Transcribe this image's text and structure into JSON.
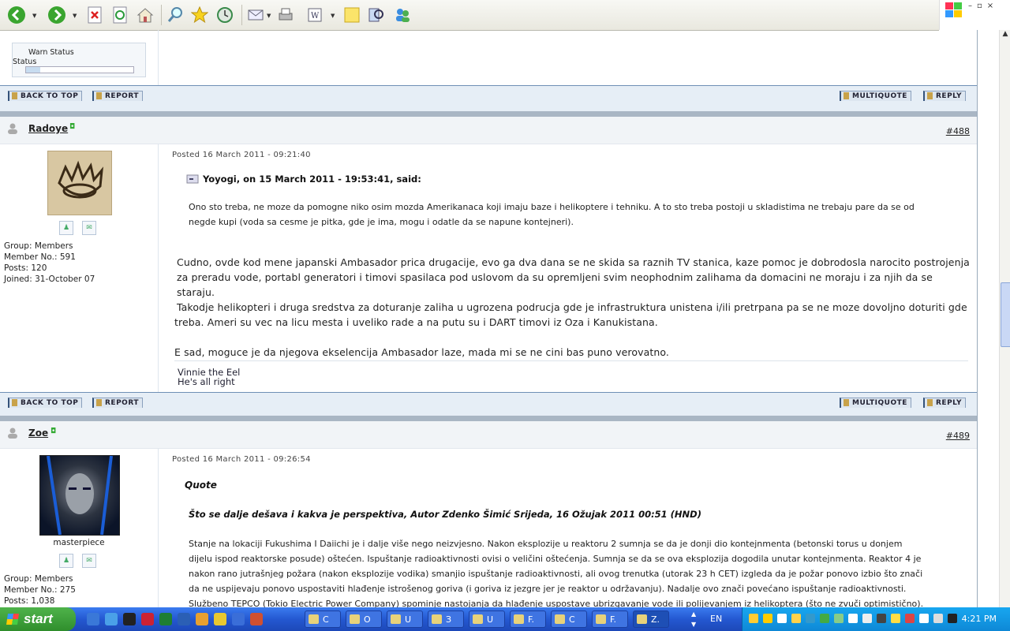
{
  "toolbar": {
    "buttons": [
      "back-icon",
      "forward-icon",
      "stop-icon",
      "refresh-icon",
      "home-icon",
      "search-icon",
      "favorites-icon",
      "history-icon",
      "mail-icon",
      "print-icon",
      "edit-icon",
      "notes-icon",
      "research-icon",
      "messenger-icon"
    ]
  },
  "prev_post": {
    "warn_label": "Warn Status",
    "status_label": "Status"
  },
  "bars": {
    "back_to_top": "BACK TO TOP",
    "report": "REPORT",
    "multiquote": "MULTIQUOTE",
    "reply": "REPLY"
  },
  "posts": [
    {
      "username": "Radoye",
      "number": "#488",
      "posted": "Posted 16 March 2011 - 09:21:40",
      "group_label": "Group:",
      "group": "Members",
      "member_no_label": "Member No.:",
      "member_no": "591",
      "posts_label": "Posts:",
      "posts": "120",
      "joined_label": "Joined:",
      "joined": "31-October 07",
      "quote_header": "Yoyogi, on 15 March 2011 - 19:53:41, said:",
      "quote_lines": [
        "Ono sto treba, ne moze da pomogne niko osim mozda Amerikanaca koji imaju baze i helikoptere i tehniku. A to sto treba postoji u skladistima ne trebaju pare da se od",
        "negde kupi (voda sa cesme je pitka, gde je ima, mogu i odatle da se napune kontejneri)."
      ],
      "body_lines": [
        "Cudno, ovde kod mene japanski Ambasador prica drugacije, evo ga dva dana se ne skida sa raznih TV stanica, kaze pomoc je dobrodosla narocito postrojenja",
        "za preradu vode, portabl generatori i timovi spasilaca pod uslovom da su opremljeni svim neophodnim zalihama da domacini ne moraju i za njih da se staraju.",
        "Takodje helikopteri i druga sredstva za doturanje zaliha u ugrozena podrucja gde je infrastruktura unistena i/ili pretrpana pa se ne moze dovoljno doturiti gde",
        "treba. Ameri su vec na licu mesta i uveliko rade a na putu su i DART timovi iz Oza i Kanukistana."
      ],
      "body_last": "E sad, moguce je da njegova ekselencija Ambasador laze, mada mi se ne cini bas puno verovatno.",
      "signature": [
        "Vinnie the Eel",
        "He's all right"
      ]
    },
    {
      "username": "Zoe",
      "number": "#489",
      "posted": "Posted 16 March 2011 - 09:26:54",
      "title": "masterpiece",
      "group_label": "Group:",
      "group": "Members",
      "member_no_label": "Member No.:",
      "member_no": "275",
      "posts_label": "Posts:",
      "posts": "1,038",
      "quote_label": "Quote",
      "quote_title": "Što se dalje dešava i kakva je perspektiva, Autor Zdenko Šimić Srijeda, 16 Ožujak 2011 00:51 (HND)",
      "quote_lines": [
        "Stanje na lokaciji Fukushima I Daiichi je i dalje više nego neizvjesno. Nakon eksplozije u reaktoru 2 sumnja se da je donji dio kontejnmenta (betonski torus u donjem",
        "dijelu ispod reaktorske posude) oštećen. Ispuštanje radioaktivnosti ovisi o veličini oštećenja. Sumnja se da se ova eksplozija dogodila unutar kontejnmenta. Reaktor 4 je",
        "nakon rano jutrašnjeg požara (nakon eksplozije vodika) smanjio ispuštanje radioaktivnosti, ali ovog trenutka (utorak 23 h CET) izgleda da je požar ponovo izbio što znači",
        "da ne uspijevaju ponovo uspostaviti hlađenje istrošenog goriva (i goriva iz jezgre jer je reaktor u održavanju). Nadalje ovo znači povećano ispuštanje radioaktivnosti.",
        "Službeno TEPCO (Tokio Electric Power Company) spominje nastojanja da hlađenje uspostave ubrizgavanje vode ili polijevanjem iz helikoptera (što ne zvuči optimistično)."
      ]
    }
  ],
  "taskbar": {
    "start": "start",
    "tasks": [
      "C",
      "O",
      "U",
      "З",
      "U",
      "F.",
      "C",
      "F.",
      "Z."
    ],
    "lang": "EN",
    "clock": "4:21 PM"
  }
}
